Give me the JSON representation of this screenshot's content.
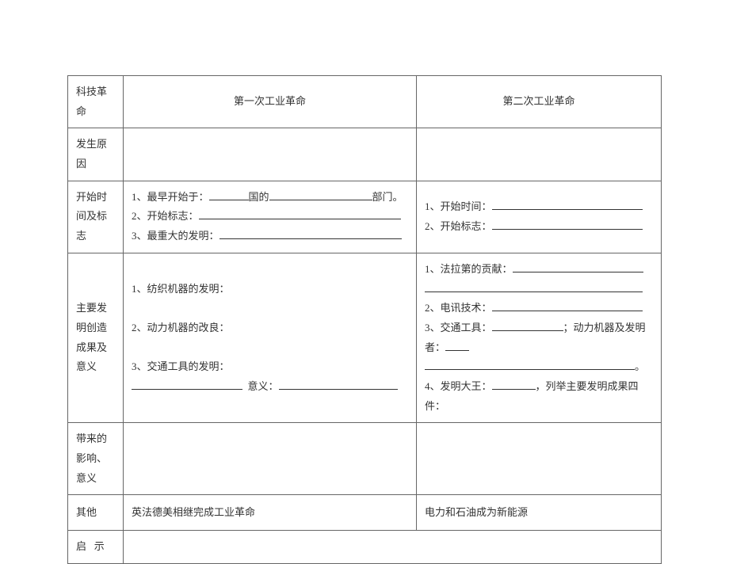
{
  "headers": {
    "row_label": "科技革命",
    "col1": "第一次工业革命",
    "col2": "第二次工业革命"
  },
  "rows": {
    "causes": {
      "label": "发生原因"
    },
    "time": {
      "label": "开始时间及标志",
      "c1_l1a": "1、最早开始于：",
      "c1_l1b": "国的",
      "c1_l1c": "部门。",
      "c1_l2": "2、开始标志：",
      "c1_l3": "3、最重大的发明：",
      "c2_l1": "1、开始时间：",
      "c2_l2": "2、开始标志："
    },
    "inventions": {
      "label": "主要发明创造成果及意义",
      "c1_l1": "1、纺织机器的发明：",
      "c1_l2": "2、动力机器的改良：",
      "c1_l3": "3、交通工具的发明：",
      "c1_l4": "意义：",
      "c2_l1": "1、法拉第的贡献：",
      "c2_l2": "2、电讯技术：",
      "c2_l3a": "3、交通工具：",
      "c2_l3b": "；动力机器及发明者：",
      "c2_l4a": "4、发明大王：",
      "c2_l4b": "，列举主要发明成果四件："
    },
    "impact": {
      "label": "带来的影响、意义"
    },
    "other": {
      "label": "其他",
      "c1": "英法德美相继完成工业革命",
      "c2": "电力和石油成为新能源"
    },
    "insight": {
      "label_a": "启",
      "label_b": "示"
    }
  }
}
